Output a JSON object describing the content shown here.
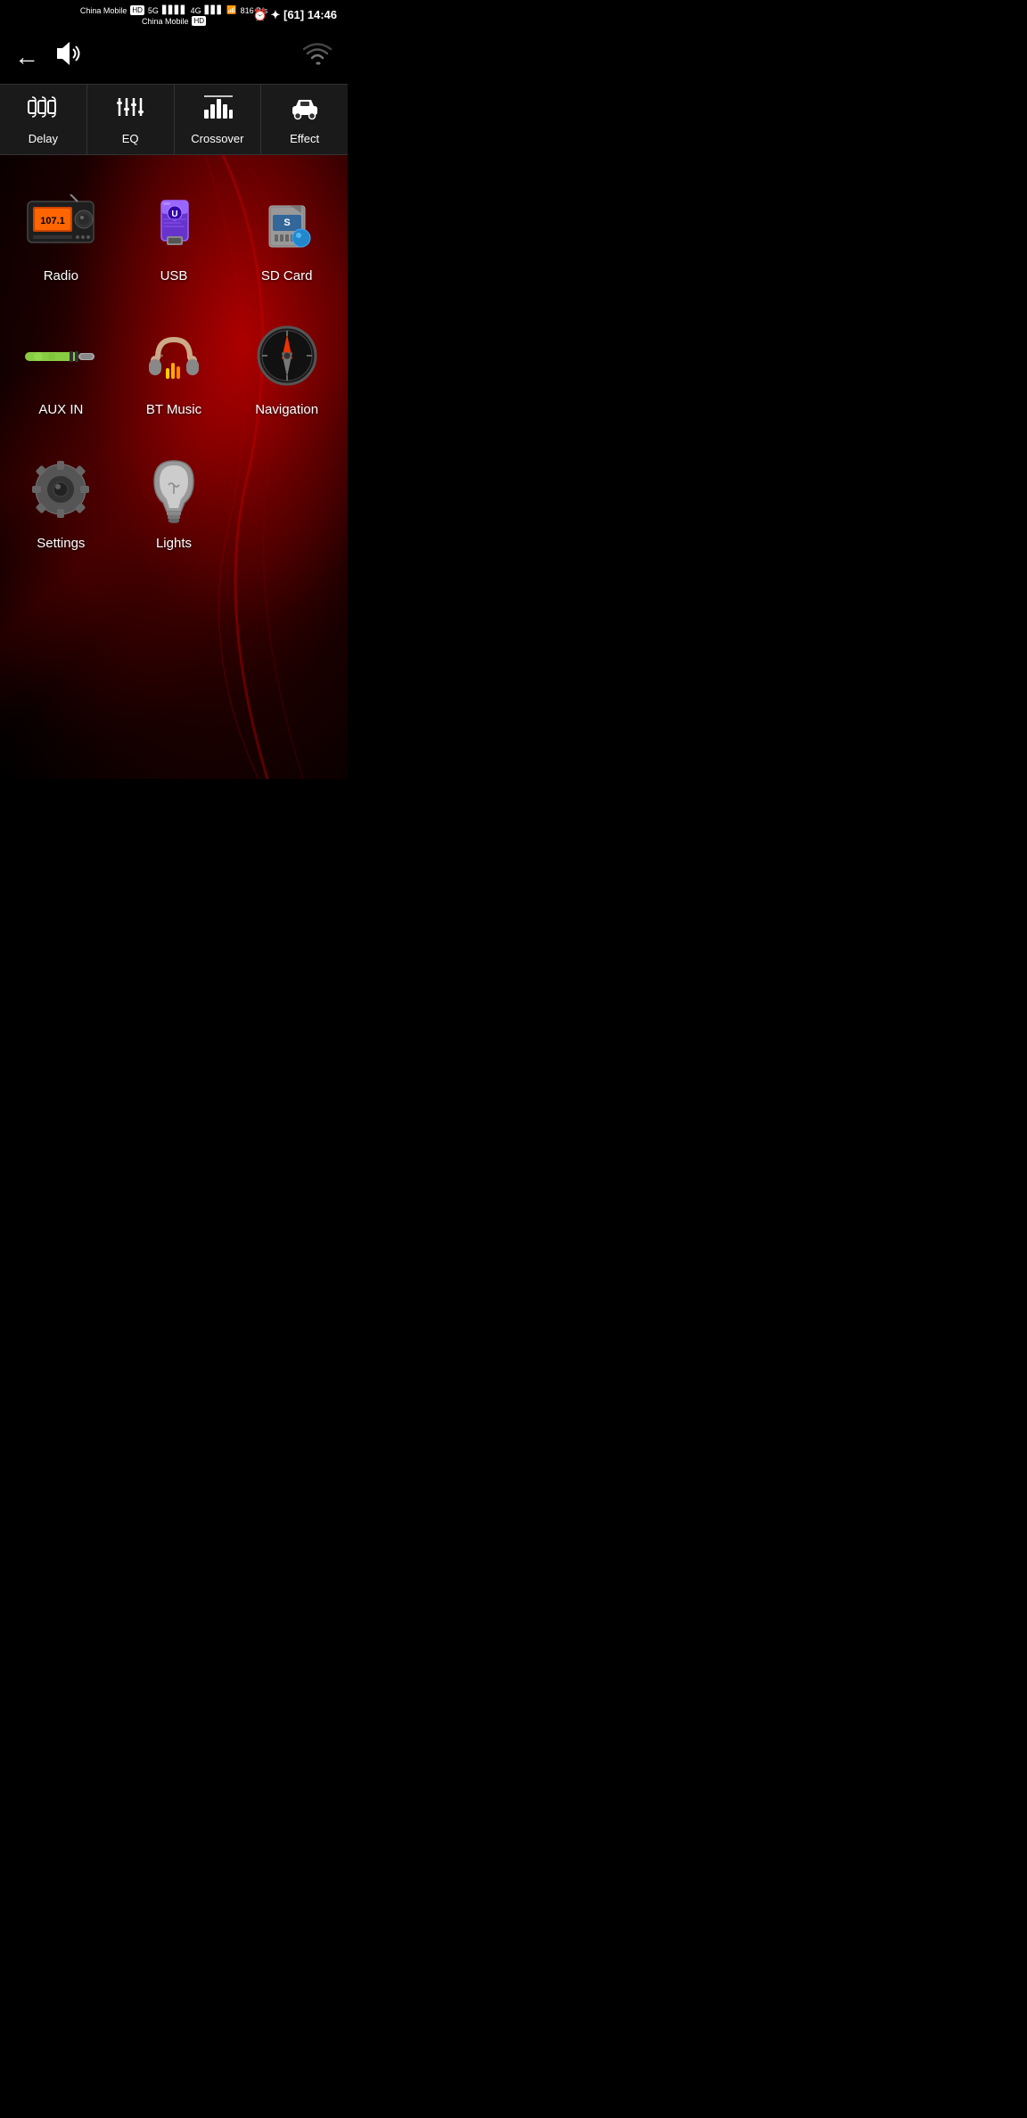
{
  "statusBar": {
    "carrier1": "China Mobile",
    "carrier1_badge": "HD",
    "carrier2": "China Mobile",
    "carrier2_badge": "HD",
    "signal_5g": "5G",
    "signal_4g": "4G",
    "data_speed": "816 B/s",
    "time": "14:46",
    "battery": "61"
  },
  "header": {
    "back_label": "←",
    "volume_label": "🔊",
    "wifi_label": "wifi"
  },
  "tabs": [
    {
      "id": "delay",
      "label": "Delay",
      "icon": "delay-icon"
    },
    {
      "id": "eq",
      "label": "EQ",
      "icon": "eq-icon"
    },
    {
      "id": "crossover",
      "label": "Crossover",
      "icon": "crossover-icon"
    },
    {
      "id": "effect",
      "label": "Effect",
      "icon": "effect-icon"
    }
  ],
  "apps": [
    {
      "id": "radio",
      "label": "Radio",
      "icon": "radio-icon"
    },
    {
      "id": "usb",
      "label": "USB",
      "icon": "usb-icon"
    },
    {
      "id": "sdcard",
      "label": "SD Card",
      "icon": "sdcard-icon"
    },
    {
      "id": "auxin",
      "label": "AUX IN",
      "icon": "auxin-icon"
    },
    {
      "id": "btmusic",
      "label": "BT Music",
      "icon": "btmusic-icon"
    },
    {
      "id": "navigation",
      "label": "Navigation",
      "icon": "navigation-icon"
    },
    {
      "id": "settings",
      "label": "Settings",
      "icon": "settings-icon"
    },
    {
      "id": "lights",
      "label": "Lights",
      "icon": "lights-icon"
    }
  ]
}
